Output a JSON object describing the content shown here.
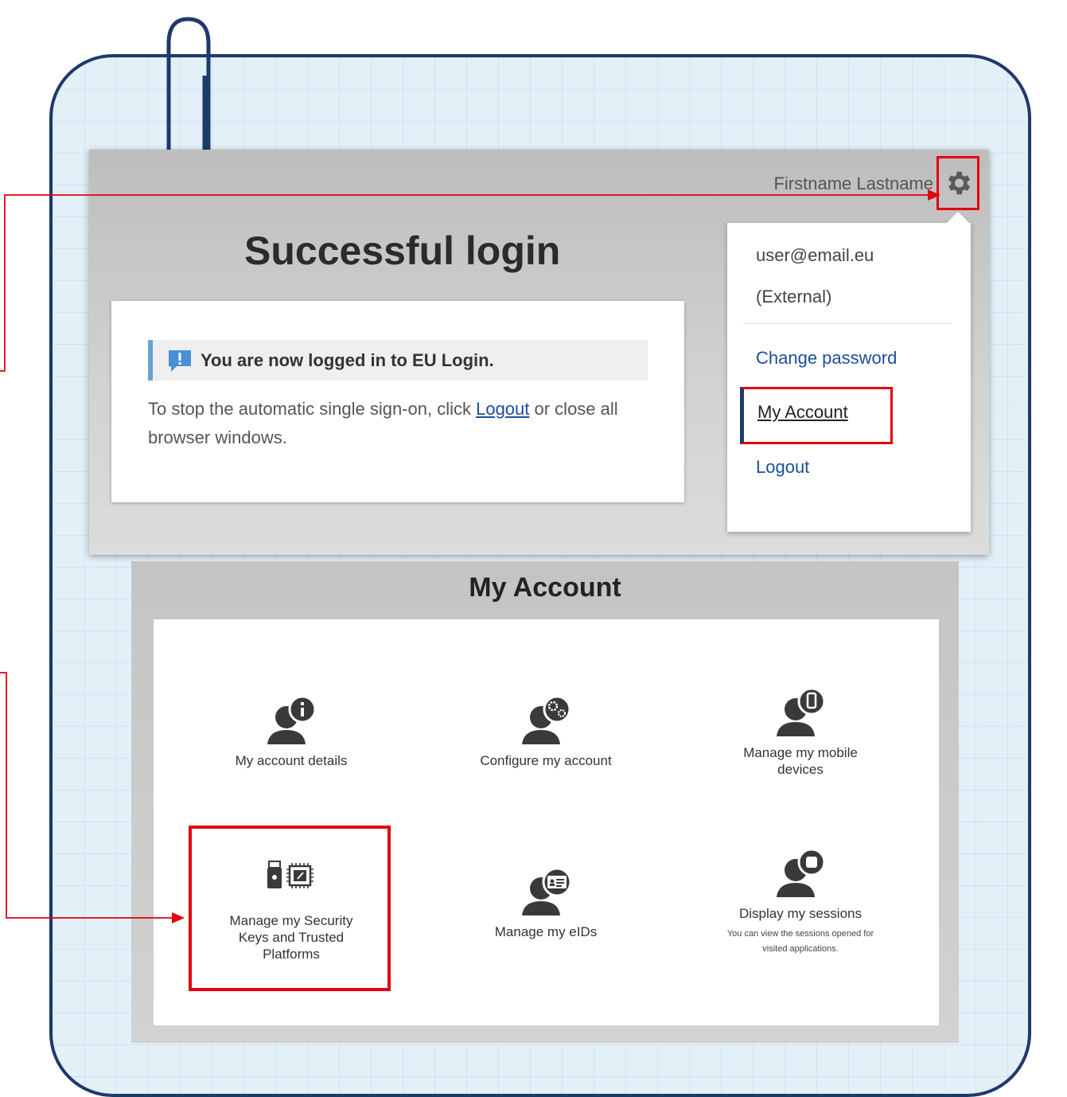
{
  "header": {
    "user_name": "Firstname Lastname"
  },
  "login": {
    "title": "Successful login",
    "notice": "You are now logged in to EU Login.",
    "message_before": "To stop the automatic single sign-on, click ",
    "message_link": "Logout",
    "message_after": " or close all browser windows."
  },
  "menu": {
    "email": "user@email.eu",
    "account_type": "(External)",
    "change_password": "Change password",
    "my_account": "My Account",
    "logout": "Logout"
  },
  "account": {
    "title": "My Account",
    "tiles": [
      {
        "label": "My account details",
        "icon": "user-info-icon"
      },
      {
        "label": "Configure my account",
        "icon": "user-settings-icon"
      },
      {
        "label": "Manage my mobile devices",
        "icon": "user-mobile-icon"
      },
      {
        "label": "Manage my Security Keys and Trusted Platforms",
        "icon": "security-key-chip-icon"
      },
      {
        "label": "Manage my eIDs",
        "icon": "user-eid-icon"
      },
      {
        "label": "Display my sessions",
        "sub": "You can view the sessions opened for visited applications.",
        "icon": "user-sessions-icon"
      }
    ]
  },
  "colors": {
    "highlight": "#e3000f",
    "link": "#1a4f9c",
    "notebook_border": "#1d3a6b"
  }
}
